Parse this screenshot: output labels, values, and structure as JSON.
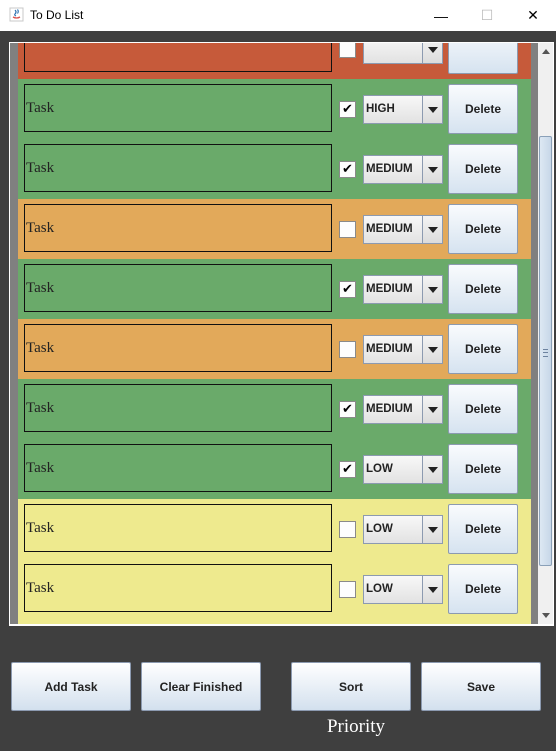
{
  "window": {
    "title": "To Do List",
    "min_symbol": "—",
    "max_symbol": "☐",
    "close_symbol": "✕"
  },
  "colors": {
    "high": "#c65a3a",
    "medium_done": "#6aaa6a",
    "medium": "#e2a95a",
    "low": "#eeea8e",
    "done": "#6aaa6a"
  },
  "tasks": [
    {
      "text": "",
      "checked": false,
      "priority": "",
      "delete_label": "",
      "color": "#c65a3a"
    },
    {
      "text": "Task",
      "checked": true,
      "priority": "HIGH",
      "delete_label": "Delete",
      "color": "#6aaa6a"
    },
    {
      "text": "Task",
      "checked": true,
      "priority": "MEDIUM",
      "delete_label": "Delete",
      "color": "#6aaa6a"
    },
    {
      "text": "Task",
      "checked": false,
      "priority": "MEDIUM",
      "delete_label": "Delete",
      "color": "#e2a95a"
    },
    {
      "text": "Task",
      "checked": true,
      "priority": "MEDIUM",
      "delete_label": "Delete",
      "color": "#6aaa6a"
    },
    {
      "text": "Task",
      "checked": false,
      "priority": "MEDIUM",
      "delete_label": "Delete",
      "color": "#e2a95a"
    },
    {
      "text": "Task",
      "checked": true,
      "priority": "MEDIUM",
      "delete_label": "Delete",
      "color": "#6aaa6a"
    },
    {
      "text": "Task",
      "checked": true,
      "priority": "LOW",
      "delete_label": "Delete",
      "color": "#6aaa6a"
    },
    {
      "text": "Task",
      "checked": false,
      "priority": "LOW",
      "delete_label": "Delete",
      "color": "#eeea8e"
    },
    {
      "text": "Task",
      "checked": false,
      "priority": "LOW",
      "delete_label": "Delete",
      "color": "#eeea8e"
    },
    {
      "text": "",
      "checked": false,
      "priority": "",
      "delete_label": "",
      "color": "#eeea8e"
    }
  ],
  "buttons": {
    "add_task": "Add Task",
    "clear_finished": "Clear Finished",
    "sort": "Sort",
    "save": "Save"
  },
  "sort_caption": "Priority",
  "check_mark": "✔"
}
